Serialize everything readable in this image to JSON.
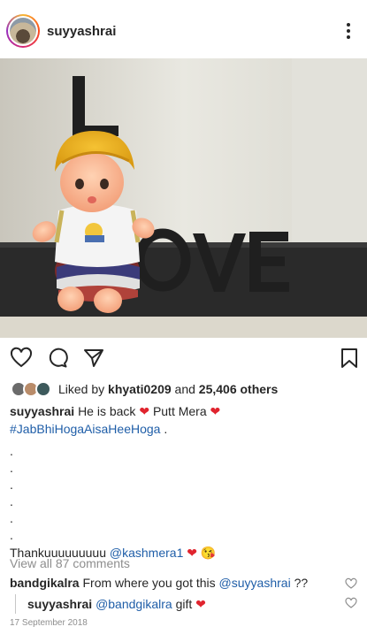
{
  "post": {
    "username": "suyyashrai",
    "image_alt": "Doll with yellow turban sitting next to LOVE letters",
    "image_letters": "LOVE"
  },
  "likes": {
    "prefix": "Liked by",
    "liker": "khyati0209",
    "middle": "and",
    "count": "25,406 others"
  },
  "caption": {
    "username": "suyyashrai",
    "text1": "He is back",
    "text2": "Putt Mera",
    "hashtag": "#JabBhiHogaAisaHeeHoga",
    "hashtag_suffix": ".",
    "dots": [
      ".",
      ".",
      ".",
      ".",
      ".",
      "."
    ],
    "last_line": "Thankuuuuuuuuu",
    "mention": "@kashmera1",
    "emoji": "😘"
  },
  "comments_link": "View all 87 comments",
  "comments": [
    {
      "username": "bandgikalra",
      "text": "From where you got this",
      "mention": "@suyyashrai",
      "suffix": "??"
    },
    {
      "username": "suyyashrai",
      "mention": "@bandgikalra",
      "text": "gift"
    }
  ],
  "date": "17 September 2018",
  "colors": {
    "heart": "#e0242e",
    "link": "#1f5ea8",
    "muted": "#8e8e8e"
  },
  "icons": [
    "more-icon",
    "heart-icon",
    "comment-icon",
    "share-icon",
    "bookmark-icon"
  ]
}
